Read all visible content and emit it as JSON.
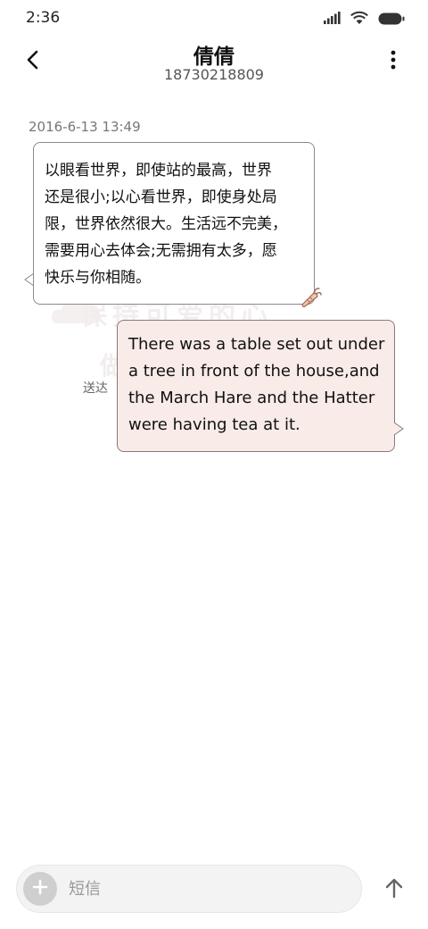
{
  "status_bar": {
    "time": "2:36"
  },
  "header": {
    "contact_name": "倩倩",
    "contact_number": "18730218809"
  },
  "conversation": {
    "timestamp": "2016-6-13 13:49",
    "incoming": {
      "lines": [
        "以眼看世界，即使站的最高，世界",
        "还是很小;以心看世界，即使身处局",
        "限，世界依然很大。生活远不完美，",
        "需要用心去体会;无需拥有太多，愿",
        "快乐与你相随。"
      ]
    },
    "outgoing": {
      "lines": [
        "There was a table set out under",
        "a tree in front of the house,and",
        "the March Hare and the Hatter",
        "were having tea at it."
      ],
      "status": "送达"
    },
    "watermark": {
      "line1": "保持可爱的心",
      "line2": "做"
    }
  },
  "compose": {
    "placeholder": "短信"
  },
  "colors": {
    "outgoing_bubble": "#f8ebe8",
    "incoming_bubble": "#ffffff",
    "bubble_border": "#8a8a8a"
  },
  "icons": {
    "back": "chevron-left-icon",
    "more": "more-vertical-icon",
    "add": "plus-icon",
    "send": "arrow-up-icon",
    "signal": "signal-icon",
    "wifi": "wifi-icon",
    "battery": "battery-icon"
  }
}
